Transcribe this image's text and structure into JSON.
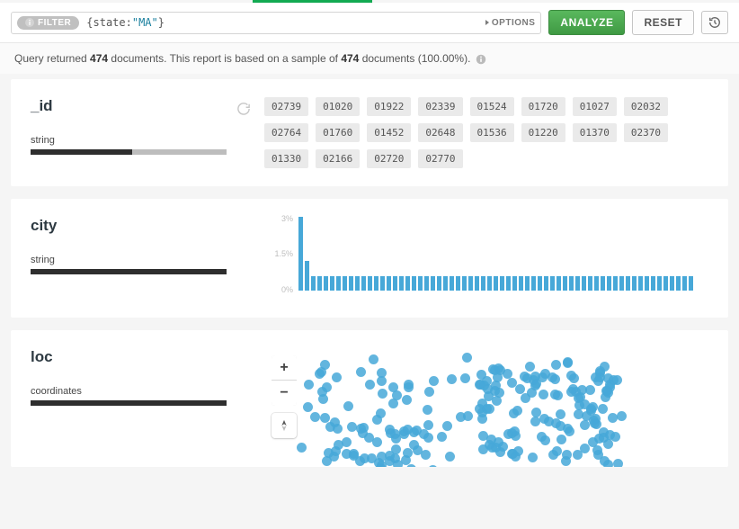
{
  "filter": {
    "pill_label": "FILTER",
    "query_open": "{",
    "query_key": "state",
    "query_colon": ":",
    "query_value": "\"MA\"",
    "query_close": "}",
    "options_label": "OPTIONS",
    "analyze_label": "ANALYZE",
    "reset_label": "RESET"
  },
  "status": {
    "prefix": "Query returned ",
    "count1": "474",
    "mid": " documents. This report is based on a sample of ",
    "count2": "474",
    "suffix": " documents (100.00%)."
  },
  "fields": {
    "id": {
      "name": "_id",
      "type": "string",
      "values": [
        "02739",
        "01020",
        "01922",
        "02339",
        "01524",
        "01720",
        "01027",
        "02032",
        "02764",
        "01760",
        "01452",
        "02648",
        "01536",
        "01220",
        "01370",
        "02370",
        "01330",
        "02166",
        "02720",
        "02770"
      ]
    },
    "city": {
      "name": "city",
      "type": "string"
    },
    "loc": {
      "name": "loc",
      "type": "coordinates"
    }
  },
  "chart_data": {
    "type": "bar",
    "title": "",
    "xlabel": "",
    "ylabel": "",
    "ylim": [
      0,
      3
    ],
    "yticks": [
      "3%",
      "1.5%",
      "0%"
    ],
    "categories_count": 63,
    "values": [
      3.0,
      1.2,
      0.6,
      0.6,
      0.6,
      0.6,
      0.6,
      0.6,
      0.6,
      0.6,
      0.6,
      0.6,
      0.6,
      0.6,
      0.6,
      0.6,
      0.6,
      0.6,
      0.6,
      0.6,
      0.6,
      0.6,
      0.6,
      0.6,
      0.6,
      0.6,
      0.6,
      0.6,
      0.6,
      0.6,
      0.6,
      0.6,
      0.6,
      0.6,
      0.6,
      0.6,
      0.6,
      0.6,
      0.6,
      0.6,
      0.6,
      0.6,
      0.6,
      0.6,
      0.6,
      0.6,
      0.6,
      0.6,
      0.6,
      0.6,
      0.6,
      0.6,
      0.6,
      0.6,
      0.6,
      0.6,
      0.6,
      0.6,
      0.6,
      0.6,
      0.6,
      0.6,
      0.6
    ]
  },
  "map": {
    "points_count": 220
  }
}
